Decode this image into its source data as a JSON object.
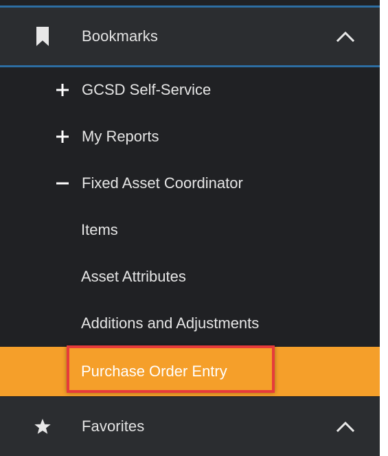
{
  "sections": {
    "bookmarks": {
      "label": "Bookmarks",
      "icon": "bookmark-icon",
      "expanded": true
    },
    "favorites": {
      "label": "Favorites",
      "icon": "star-icon",
      "expanded": true
    }
  },
  "bookmarks_items": [
    {
      "label": "GCSD Self-Service",
      "type": "group",
      "state": "collapsed"
    },
    {
      "label": "My Reports",
      "type": "group",
      "state": "collapsed"
    },
    {
      "label": "Fixed Asset Coordinator",
      "type": "group",
      "state": "expanded"
    },
    {
      "label": "Items",
      "type": "child"
    },
    {
      "label": "Asset Attributes",
      "type": "child"
    },
    {
      "label": "Additions and Adjustments",
      "type": "child"
    },
    {
      "label": "Purchase Order Entry",
      "type": "child",
      "selected": true
    }
  ],
  "colors": {
    "panel_bg": "#202124",
    "header_bg": "#2b2d30",
    "accent_blue": "#2d6ea3",
    "selected_bg": "#f59f2a",
    "highlight_red": "#e63b3b",
    "text": "#e6e6e6"
  }
}
